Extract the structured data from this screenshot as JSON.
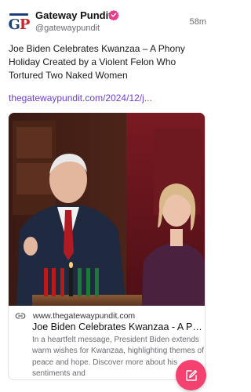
{
  "post": {
    "author_name": "Gateway Pundit",
    "author_handle": "@gatewaypundit",
    "timestamp": "58m",
    "avatar_text_g": "G",
    "avatar_text_p": "P",
    "text": "Joe Biden Celebrates Kwanzaa – A Phony Holiday Created by a Violent Felon Who Tortured Two Naked Women",
    "link": "thegatewaypundit.com/2024/12/j..."
  },
  "card": {
    "domain": "www.thegatewaypundit.com",
    "title": "Joe Biden Celebrates Kwanzaa - A Ph...",
    "description": "In a heartfelt message, President Biden extends warm wishes for Kwanzaa, highlighting themes of peace and hope. Discover more about his sentiments and"
  },
  "icons": {
    "verified": "verified-badge-icon",
    "link": "link-icon",
    "compose": "compose-icon"
  },
  "colors": {
    "link": "#6c3fd1",
    "verified": "#e83e8c",
    "fab": "#f4416f",
    "avatar_blue": "#1d3f7a",
    "avatar_red": "#c8262d"
  }
}
